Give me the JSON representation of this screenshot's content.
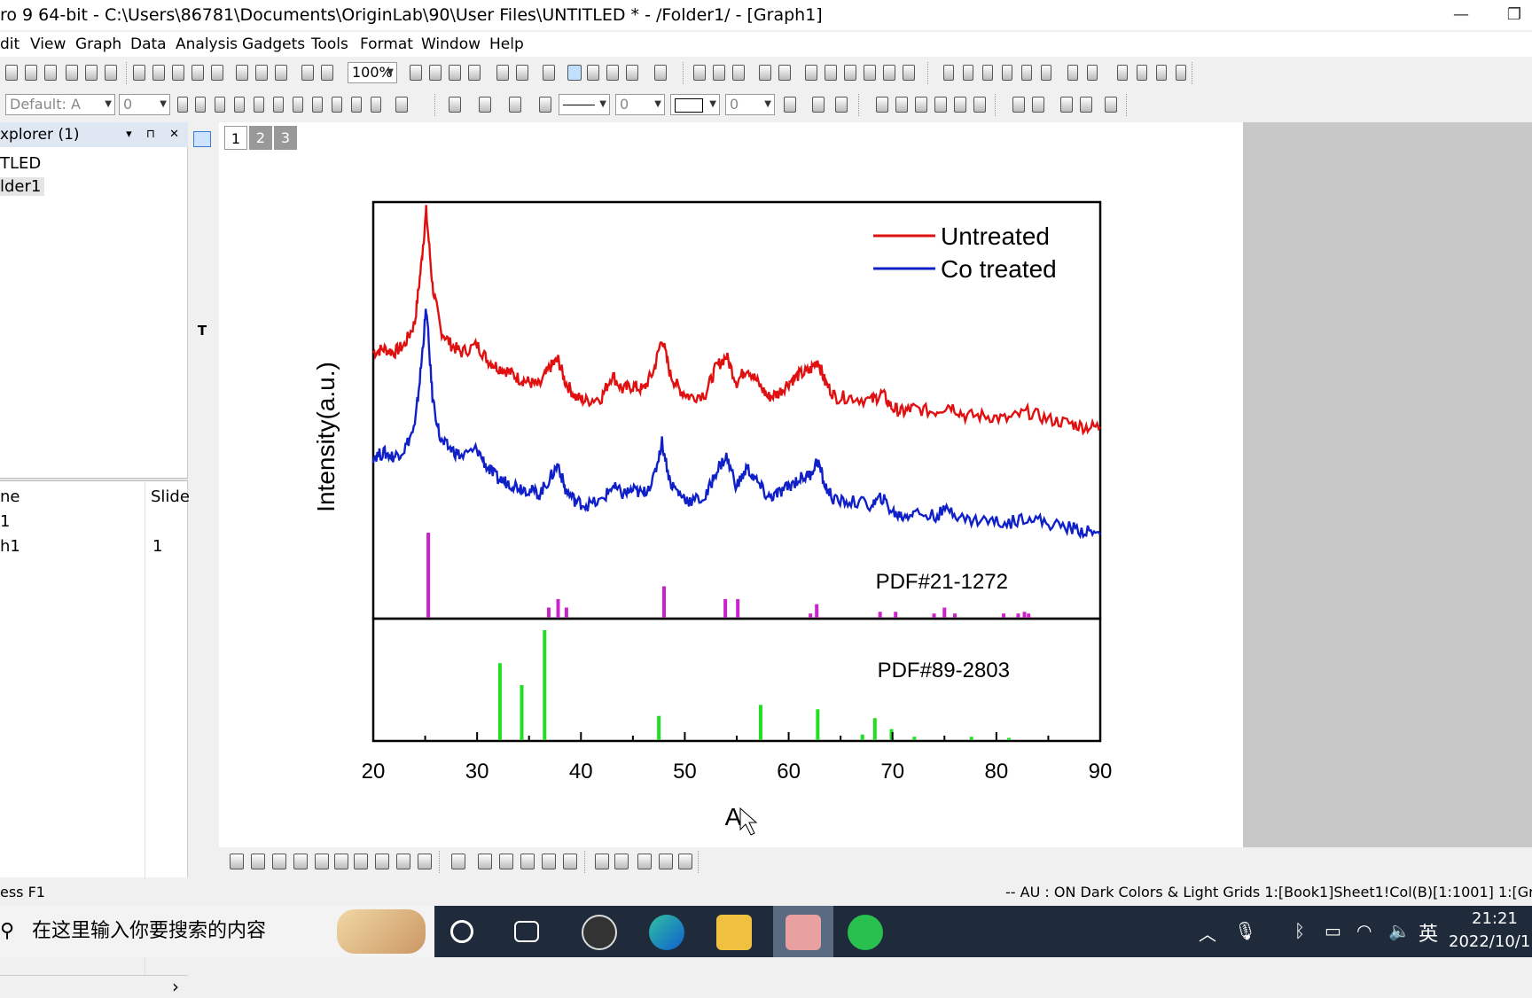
{
  "window": {
    "title": "ro 9 64-bit - C:\\Users\\86781\\Documents\\OriginLab\\90\\User Files\\UNTITLED * - /Folder1/ - [Graph1]",
    "minimize_glyph": "—",
    "maximize_glyph": "❐"
  },
  "menu": [
    "dit",
    "View",
    "Graph",
    "Data",
    "Analysis",
    "Gadgets",
    "Tools",
    "Format",
    "Window",
    "Help"
  ],
  "toolbar": {
    "zoom": "100%",
    "font_default": "Default: A",
    "font_size": "0",
    "line_width": "0",
    "border_width": "0"
  },
  "explorer": {
    "title": "xplorer (1)",
    "buttons": "▾ ⊓ ✕",
    "tree": [
      "TLED",
      "lder1"
    ],
    "columns": {
      "name": "ne",
      "slide": "Slide"
    },
    "rows": [
      {
        "name": "1",
        "slide": ""
      },
      {
        "name": "h1",
        "slide": "1"
      }
    ],
    "scroll_arrow": "›"
  },
  "page_tabs": [
    "1",
    "2",
    "3"
  ],
  "status": {
    "left": "ess F1",
    "right": "-- AU : ON  Dark Colors & Light Grids  1:[Book1]Sheet1!Col(B)[1:1001]  1:[Graph"
  },
  "taskbar": {
    "search_placeholder": "在这里输入你要搜索的内容",
    "time": "21:21",
    "date": "2022/10/1",
    "ime": "英"
  },
  "colors": {
    "untreated": "#e01010",
    "co_treated": "#1020c8",
    "pdf_a": "#cc22cc",
    "pdf_b": "#22dd22"
  },
  "chart_data": {
    "type": "line",
    "xlabel": "A",
    "ylabel": "Intensity(a.u.)",
    "xlim": [
      20,
      90
    ],
    "xticks": [
      "20",
      "30",
      "40",
      "50",
      "60",
      "70",
      "80",
      "90"
    ],
    "legend_position": "top-right",
    "series": [
      {
        "name": "Untreated",
        "x": [
          20,
          21,
          22,
          23,
          24,
          24.6,
          25.1,
          25.7,
          26.5,
          27.5,
          28.5,
          30,
          31,
          32,
          33,
          34,
          35,
          36,
          37,
          37.8,
          38.5,
          39.5,
          40.5,
          42,
          43,
          44,
          45,
          46,
          47,
          47.8,
          48.6,
          49.5,
          50.5,
          52,
          53,
          54,
          55,
          56,
          57,
          58,
          59,
          60,
          61,
          62,
          62.8,
          63.5,
          64.5,
          66,
          68,
          69,
          70,
          71,
          72,
          74,
          75.5,
          77,
          79,
          81,
          83,
          85,
          87,
          88.5,
          90
        ],
        "y": [
          0.62,
          0.63,
          0.62,
          0.64,
          0.7,
          0.85,
          1.0,
          0.8,
          0.68,
          0.64,
          0.62,
          0.64,
          0.6,
          0.58,
          0.57,
          0.55,
          0.54,
          0.53,
          0.58,
          0.6,
          0.54,
          0.5,
          0.49,
          0.5,
          0.56,
          0.52,
          0.53,
          0.52,
          0.57,
          0.66,
          0.56,
          0.52,
          0.5,
          0.51,
          0.58,
          0.61,
          0.54,
          0.58,
          0.54,
          0.5,
          0.51,
          0.54,
          0.56,
          0.57,
          0.6,
          0.54,
          0.5,
          0.5,
          0.49,
          0.51,
          0.47,
          0.46,
          0.47,
          0.46,
          0.48,
          0.45,
          0.45,
          0.44,
          0.46,
          0.44,
          0.43,
          0.42,
          0.42
        ]
      },
      {
        "name": "Co treated",
        "x": [
          20,
          21,
          22,
          23,
          24,
          24.6,
          25.1,
          25.7,
          26.5,
          27.5,
          28.5,
          30,
          31,
          32,
          33,
          34,
          35,
          36,
          37,
          37.8,
          38.5,
          39.5,
          40.5,
          42,
          43,
          44,
          45,
          46,
          47,
          47.8,
          48.6,
          49.5,
          50.5,
          52,
          53,
          54,
          55,
          56,
          57,
          58,
          59,
          60,
          61,
          62,
          62.8,
          63.5,
          64.5,
          66,
          68,
          69,
          70,
          71,
          72,
          74,
          75.5,
          77,
          79,
          81,
          83,
          85,
          87,
          88.5,
          90
        ],
        "y": [
          0.34,
          0.35,
          0.34,
          0.36,
          0.42,
          0.58,
          0.74,
          0.5,
          0.38,
          0.36,
          0.34,
          0.36,
          0.31,
          0.28,
          0.27,
          0.26,
          0.25,
          0.24,
          0.28,
          0.32,
          0.25,
          0.22,
          0.21,
          0.22,
          0.26,
          0.24,
          0.25,
          0.24,
          0.28,
          0.38,
          0.27,
          0.24,
          0.22,
          0.23,
          0.3,
          0.34,
          0.26,
          0.31,
          0.27,
          0.23,
          0.24,
          0.26,
          0.28,
          0.29,
          0.33,
          0.26,
          0.22,
          0.22,
          0.21,
          0.23,
          0.19,
          0.18,
          0.19,
          0.18,
          0.2,
          0.17,
          0.17,
          0.16,
          0.18,
          0.16,
          0.15,
          0.14,
          0.13
        ]
      }
    ],
    "references": [
      {
        "label": "PDF#21-1272",
        "peaks": [
          [
            25.3,
            100
          ],
          [
            36.9,
            12
          ],
          [
            37.8,
            22
          ],
          [
            38.6,
            12
          ],
          [
            48.0,
            37
          ],
          [
            53.9,
            22
          ],
          [
            55.1,
            22
          ],
          [
            62.1,
            5
          ],
          [
            62.7,
            16
          ],
          [
            68.8,
            7
          ],
          [
            70.3,
            7
          ],
          [
            74.0,
            5
          ],
          [
            75.0,
            12
          ],
          [
            76.0,
            5
          ],
          [
            80.7,
            5
          ],
          [
            82.1,
            5
          ],
          [
            82.7,
            7
          ],
          [
            83.1,
            5
          ]
        ]
      },
      {
        "label": "PDF#89-2803",
        "peaks": [
          [
            32.2,
            70
          ],
          [
            34.3,
            50
          ],
          [
            36.5,
            100
          ],
          [
            47.5,
            22
          ],
          [
            57.3,
            32
          ],
          [
            62.8,
            28
          ],
          [
            67.1,
            5
          ],
          [
            68.3,
            20
          ],
          [
            69.9,
            10
          ],
          [
            72.1,
            3
          ],
          [
            77.6,
            3
          ],
          [
            81.2,
            2
          ]
        ]
      }
    ]
  }
}
